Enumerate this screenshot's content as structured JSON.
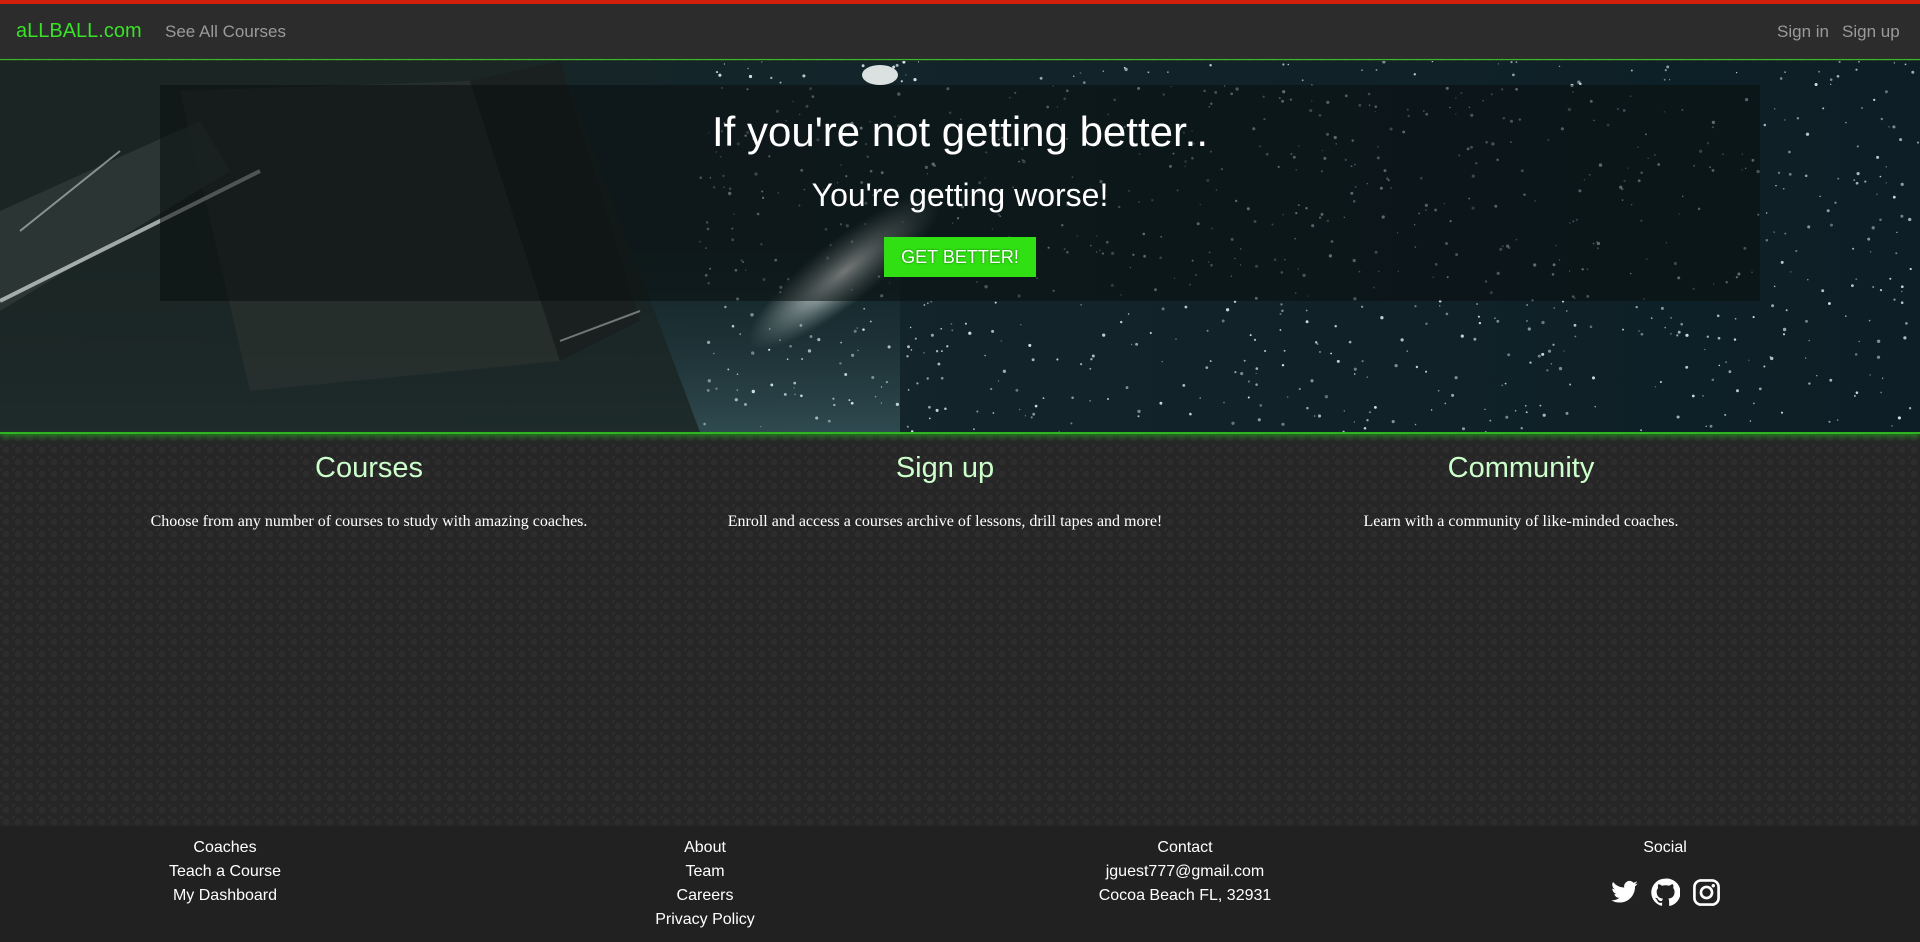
{
  "navbar": {
    "brand": "aLLBALL.com",
    "see_all_courses": "See All Courses",
    "sign_in": "Sign in",
    "sign_up": "Sign up"
  },
  "hero": {
    "title": "If you're not getting better..",
    "subtitle": "You're getting worse!",
    "cta_label": "GET BETTER!"
  },
  "features": [
    {
      "title": "Courses",
      "text": "Choose from any number of courses to study with amazing coaches."
    },
    {
      "title": "Sign up",
      "text": "Enroll and access a courses archive of lessons, drill tapes and more!"
    },
    {
      "title": "Community",
      "text": "Learn with a community of like-minded coaches."
    }
  ],
  "footer": {
    "coaches": [
      "Coaches",
      "Teach a Course",
      "My Dashboard"
    ],
    "about": [
      "About",
      "Team",
      "Careers",
      "Privacy Policy"
    ],
    "contact": [
      "Contact",
      "jguest777@gmail.com",
      "Cocoa Beach FL, 32931"
    ],
    "social": {
      "title": "Social",
      "icons": [
        "twitter-icon",
        "github-icon",
        "instagram-icon"
      ]
    }
  },
  "colors": {
    "brand": "#39e127",
    "accent_green": "#30e012",
    "top_border": "#d3200d",
    "feature_heading": "#ccffcc"
  }
}
